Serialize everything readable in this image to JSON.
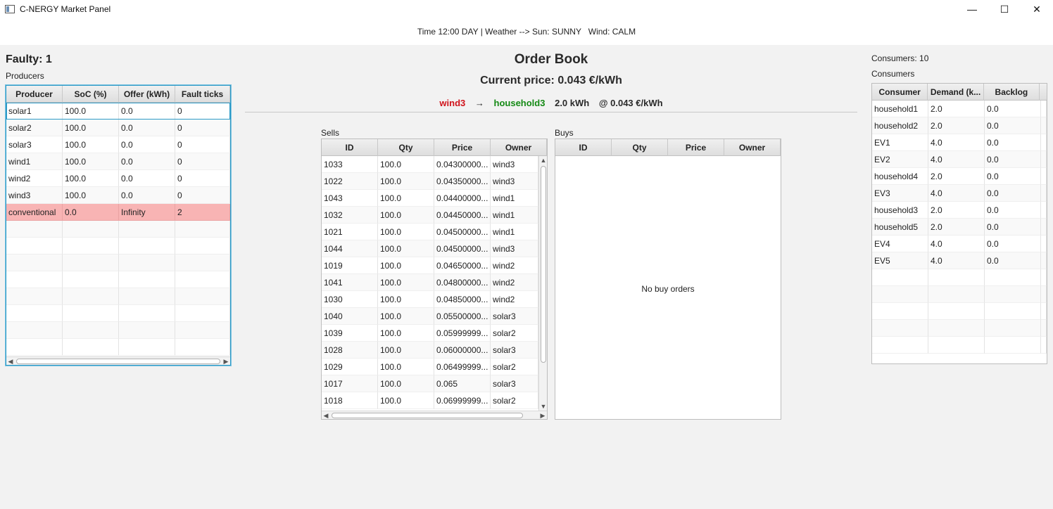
{
  "window": {
    "title": "C-NERGY Market Panel",
    "minimize": "—",
    "maximize": "☐",
    "close": "✕"
  },
  "status": {
    "text": "Time 12:00 DAY | Weather --> Sun: SUNNY   Wind: CALM"
  },
  "producers": {
    "faulty_label": "Faulty: 1",
    "label": "Producers",
    "columns": [
      "Producer",
      "SoC (%)",
      "Offer (kWh)",
      "Fault ticks"
    ],
    "rows": [
      [
        "solar1",
        "100.0",
        "0.0",
        "0"
      ],
      [
        "solar2",
        "100.0",
        "0.0",
        "0"
      ],
      [
        "solar3",
        "100.0",
        "0.0",
        "0"
      ],
      [
        "wind1",
        "100.0",
        "0.0",
        "0"
      ],
      [
        "wind2",
        "100.0",
        "0.0",
        "0"
      ],
      [
        "wind3",
        "100.0",
        "0.0",
        "0"
      ],
      [
        "conventional",
        "0.0",
        "Infinity",
        "2"
      ]
    ],
    "faulty_row": 6,
    "selected_row": 0,
    "fault_color": "#f8b4b4"
  },
  "order_book": {
    "title": "Order Book",
    "current_price": "Current price: 0.043 €/kWh",
    "last_trade": {
      "seller": "wind3",
      "arrow": "→",
      "buyer": "household3",
      "qty": "2.0 kWh",
      "price": "@ 0.043 €/kWh"
    },
    "seller_color": "#d0141c",
    "buyer_color": "#158a15",
    "sells": {
      "label": "Sells",
      "columns": [
        "ID",
        "Qty",
        "Price",
        "Owner"
      ],
      "rows": [
        [
          "1033",
          "100.0",
          "0.04300000...",
          "wind3"
        ],
        [
          "1022",
          "100.0",
          "0.04350000...",
          "wind3"
        ],
        [
          "1043",
          "100.0",
          "0.04400000...",
          "wind1"
        ],
        [
          "1032",
          "100.0",
          "0.04450000...",
          "wind1"
        ],
        [
          "1021",
          "100.0",
          "0.04500000...",
          "wind1"
        ],
        [
          "1044",
          "100.0",
          "0.04500000...",
          "wind3"
        ],
        [
          "1019",
          "100.0",
          "0.04650000...",
          "wind2"
        ],
        [
          "1041",
          "100.0",
          "0.04800000...",
          "wind2"
        ],
        [
          "1030",
          "100.0",
          "0.04850000...",
          "wind2"
        ],
        [
          "1040",
          "100.0",
          "0.05500000...",
          "solar3"
        ],
        [
          "1039",
          "100.0",
          "0.05999999...",
          "solar2"
        ],
        [
          "1028",
          "100.0",
          "0.06000000...",
          "solar3"
        ],
        [
          "1029",
          "100.0",
          "0.06499999...",
          "solar2"
        ],
        [
          "1017",
          "100.0",
          "0.065",
          "solar3"
        ],
        [
          "1018",
          "100.0",
          "0.06999999...",
          "solar2"
        ]
      ]
    },
    "buys": {
      "label": "Buys",
      "columns": [
        "ID",
        "Qty",
        "Price",
        "Owner"
      ],
      "empty_message": "No buy orders"
    }
  },
  "consumers": {
    "count_label": "Consumers: 10",
    "label": "Consumers",
    "columns": [
      "Consumer",
      "Demand (k...",
      "Backlog"
    ],
    "rows": [
      [
        "household1",
        "2.0",
        "0.0"
      ],
      [
        "household2",
        "2.0",
        "0.0"
      ],
      [
        "EV1",
        "4.0",
        "0.0"
      ],
      [
        "EV2",
        "4.0",
        "0.0"
      ],
      [
        "household4",
        "2.0",
        "0.0"
      ],
      [
        "EV3",
        "4.0",
        "0.0"
      ],
      [
        "household3",
        "2.0",
        "0.0"
      ],
      [
        "household5",
        "2.0",
        "0.0"
      ],
      [
        "EV4",
        "4.0",
        "0.0"
      ],
      [
        "EV5",
        "4.0",
        "0.0"
      ]
    ]
  }
}
